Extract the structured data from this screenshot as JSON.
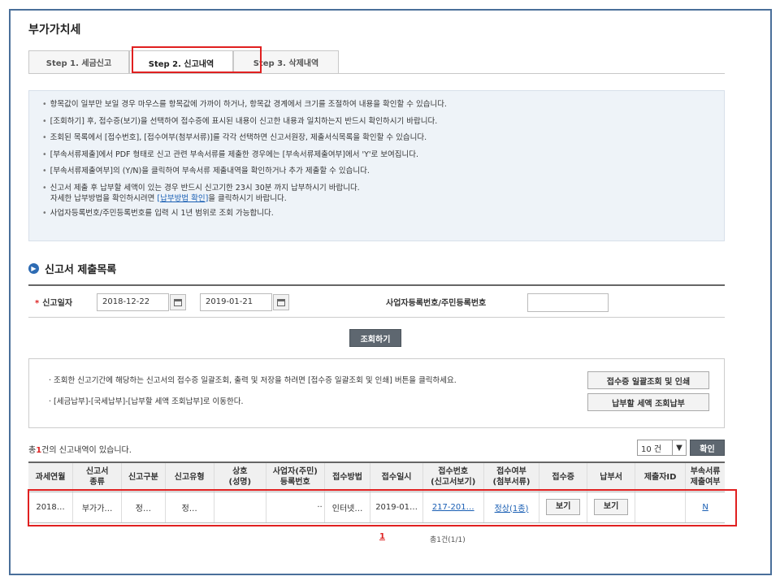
{
  "page": {
    "title": "부가가치세"
  },
  "tabs": [
    {
      "label": "Step 1. 세금신고"
    },
    {
      "label": "Step 2. 신고내역"
    },
    {
      "label": "Step 3. 삭제내역"
    }
  ],
  "notice": {
    "lines": [
      "항목값이 일부만 보일 경우 마우스를 항목값에 가까이 하거나, 항목값 경계에서 크기를 조절하여 내용을 확인할 수 있습니다.",
      "[조회하기] 후, 접수증(보기)을 선택하여 접수증에 표시된 내용이 신고한 내용과 일치하는지 반드시 확인하시기 바랍니다.",
      "조회된 목록에서 [접수번호], [접수여부(첨부서류)]를 각각 선택하면 신고서원장, 제출서식목록을 확인할 수 있습니다.",
      "[부속서류제출]에서 PDF 형태로 신고 관련 부속서류를 제출한 경우에는 [부속서류제출여부]에서 'Y'로 보여집니다.",
      "[부속서류제출여부]의 (Y/N)을 클릭하여 부속서류 제출내역을 확인하거나 추가 제출할 수 있습니다.",
      "신고서 제출 후 납부할 세액이 있는 경우 반드시 신고기한 23시 30분 까지 납부하시기 바랍니다."
    ],
    "line6_sub_prefix": "자세한 납부방법을 확인하시려면 ",
    "line6_sub_link": "[납부방법 확인]",
    "line6_sub_suffix": "을 클릭하시기 바랍니다.",
    "line7": "사업자등록번호/주민등록번호를 입력 시 1년 범위로 조회 가능합니다."
  },
  "section": {
    "title": "신고서 제출목록"
  },
  "search": {
    "date_label": "신고일자",
    "date_from": "2018-12-22",
    "date_to": "2019-01-21",
    "tilde": "~",
    "biz_label": "사업자등록번호/주민등록번호",
    "biz_value": "",
    "submit_label": "조회하기"
  },
  "info": {
    "line1": "· 조회한 신고기간에 해당하는 신고서의 접수증 일괄조회, 출력 및 저장을 하려면 [접수증 일괄조회 및 인쇄] 버튼을 클릭하세요.",
    "line2": "· [세금납부]-[국세납부]-[납부할 세액 조회납부]로 이동한다.",
    "btn_receipt": "접수증 일괄조회 및 인쇄",
    "btn_pay": "납부할 세액 조회납부"
  },
  "results": {
    "total_prefix": "총",
    "total_count": "1",
    "total_suffix": "건의 신고내역이 있습니다.",
    "page_size": "10 건",
    "confirm_label": "확인"
  },
  "table": {
    "headers": [
      [
        "과세연월",
        ""
      ],
      [
        "신고서",
        "종류"
      ],
      [
        "신고구분",
        ""
      ],
      [
        "신고유형",
        ""
      ],
      [
        "상호",
        "(성명)"
      ],
      [
        "사업자(주민)",
        "등록번호"
      ],
      [
        "접수방법",
        ""
      ],
      [
        "접수일시",
        ""
      ],
      [
        "접수번호",
        "(신고서보기)"
      ],
      [
        "접수여부",
        "(첨부서류)"
      ],
      [
        "접수증",
        ""
      ],
      [
        "납부서",
        ""
      ],
      [
        "제출자ID",
        ""
      ],
      [
        "부속서류",
        "제출여부"
      ]
    ],
    "row": {
      "period": "2018…",
      "form_type": "부가가…",
      "report_div": "정…",
      "report_type": "정…",
      "company": "",
      "reg_no": "··",
      "method": "인터넷…",
      "received_at": "2019-01…",
      "receipt_no": "217-201…",
      "status": "정상(1종)",
      "receipt_btn": "보기",
      "payment_btn": "보기",
      "submitter": "",
      "attach": "N"
    }
  },
  "pagination": {
    "current": "1",
    "info": "총1건(1/1)"
  }
}
